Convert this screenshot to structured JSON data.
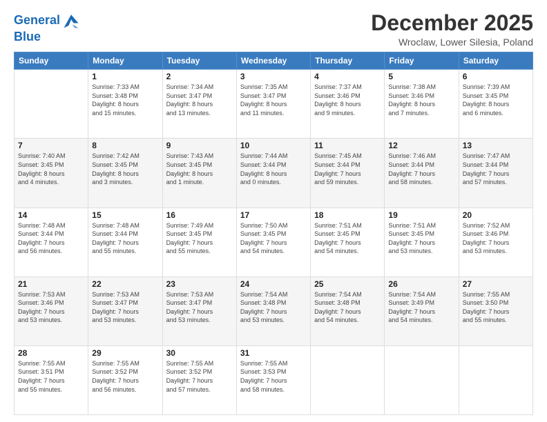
{
  "header": {
    "logo_line1": "General",
    "logo_line2": "Blue",
    "month": "December 2025",
    "location": "Wroclaw, Lower Silesia, Poland"
  },
  "days_of_week": [
    "Sunday",
    "Monday",
    "Tuesday",
    "Wednesday",
    "Thursday",
    "Friday",
    "Saturday"
  ],
  "weeks": [
    [
      {
        "day": "",
        "info": ""
      },
      {
        "day": "1",
        "info": "Sunrise: 7:33 AM\nSunset: 3:48 PM\nDaylight: 8 hours\nand 15 minutes."
      },
      {
        "day": "2",
        "info": "Sunrise: 7:34 AM\nSunset: 3:47 PM\nDaylight: 8 hours\nand 13 minutes."
      },
      {
        "day": "3",
        "info": "Sunrise: 7:35 AM\nSunset: 3:47 PM\nDaylight: 8 hours\nand 11 minutes."
      },
      {
        "day": "4",
        "info": "Sunrise: 7:37 AM\nSunset: 3:46 PM\nDaylight: 8 hours\nand 9 minutes."
      },
      {
        "day": "5",
        "info": "Sunrise: 7:38 AM\nSunset: 3:46 PM\nDaylight: 8 hours\nand 7 minutes."
      },
      {
        "day": "6",
        "info": "Sunrise: 7:39 AM\nSunset: 3:45 PM\nDaylight: 8 hours\nand 6 minutes."
      }
    ],
    [
      {
        "day": "7",
        "info": "Sunrise: 7:40 AM\nSunset: 3:45 PM\nDaylight: 8 hours\nand 4 minutes."
      },
      {
        "day": "8",
        "info": "Sunrise: 7:42 AM\nSunset: 3:45 PM\nDaylight: 8 hours\nand 3 minutes."
      },
      {
        "day": "9",
        "info": "Sunrise: 7:43 AM\nSunset: 3:45 PM\nDaylight: 8 hours\nand 1 minute."
      },
      {
        "day": "10",
        "info": "Sunrise: 7:44 AM\nSunset: 3:44 PM\nDaylight: 8 hours\nand 0 minutes."
      },
      {
        "day": "11",
        "info": "Sunrise: 7:45 AM\nSunset: 3:44 PM\nDaylight: 7 hours\nand 59 minutes."
      },
      {
        "day": "12",
        "info": "Sunrise: 7:46 AM\nSunset: 3:44 PM\nDaylight: 7 hours\nand 58 minutes."
      },
      {
        "day": "13",
        "info": "Sunrise: 7:47 AM\nSunset: 3:44 PM\nDaylight: 7 hours\nand 57 minutes."
      }
    ],
    [
      {
        "day": "14",
        "info": "Sunrise: 7:48 AM\nSunset: 3:44 PM\nDaylight: 7 hours\nand 56 minutes."
      },
      {
        "day": "15",
        "info": "Sunrise: 7:48 AM\nSunset: 3:44 PM\nDaylight: 7 hours\nand 55 minutes."
      },
      {
        "day": "16",
        "info": "Sunrise: 7:49 AM\nSunset: 3:45 PM\nDaylight: 7 hours\nand 55 minutes."
      },
      {
        "day": "17",
        "info": "Sunrise: 7:50 AM\nSunset: 3:45 PM\nDaylight: 7 hours\nand 54 minutes."
      },
      {
        "day": "18",
        "info": "Sunrise: 7:51 AM\nSunset: 3:45 PM\nDaylight: 7 hours\nand 54 minutes."
      },
      {
        "day": "19",
        "info": "Sunrise: 7:51 AM\nSunset: 3:45 PM\nDaylight: 7 hours\nand 53 minutes."
      },
      {
        "day": "20",
        "info": "Sunrise: 7:52 AM\nSunset: 3:46 PM\nDaylight: 7 hours\nand 53 minutes."
      }
    ],
    [
      {
        "day": "21",
        "info": "Sunrise: 7:53 AM\nSunset: 3:46 PM\nDaylight: 7 hours\nand 53 minutes."
      },
      {
        "day": "22",
        "info": "Sunrise: 7:53 AM\nSunset: 3:47 PM\nDaylight: 7 hours\nand 53 minutes."
      },
      {
        "day": "23",
        "info": "Sunrise: 7:53 AM\nSunset: 3:47 PM\nDaylight: 7 hours\nand 53 minutes."
      },
      {
        "day": "24",
        "info": "Sunrise: 7:54 AM\nSunset: 3:48 PM\nDaylight: 7 hours\nand 53 minutes."
      },
      {
        "day": "25",
        "info": "Sunrise: 7:54 AM\nSunset: 3:48 PM\nDaylight: 7 hours\nand 54 minutes."
      },
      {
        "day": "26",
        "info": "Sunrise: 7:54 AM\nSunset: 3:49 PM\nDaylight: 7 hours\nand 54 minutes."
      },
      {
        "day": "27",
        "info": "Sunrise: 7:55 AM\nSunset: 3:50 PM\nDaylight: 7 hours\nand 55 minutes."
      }
    ],
    [
      {
        "day": "28",
        "info": "Sunrise: 7:55 AM\nSunset: 3:51 PM\nDaylight: 7 hours\nand 55 minutes."
      },
      {
        "day": "29",
        "info": "Sunrise: 7:55 AM\nSunset: 3:52 PM\nDaylight: 7 hours\nand 56 minutes."
      },
      {
        "day": "30",
        "info": "Sunrise: 7:55 AM\nSunset: 3:52 PM\nDaylight: 7 hours\nand 57 minutes."
      },
      {
        "day": "31",
        "info": "Sunrise: 7:55 AM\nSunset: 3:53 PM\nDaylight: 7 hours\nand 58 minutes."
      },
      {
        "day": "",
        "info": ""
      },
      {
        "day": "",
        "info": ""
      },
      {
        "day": "",
        "info": ""
      }
    ]
  ]
}
